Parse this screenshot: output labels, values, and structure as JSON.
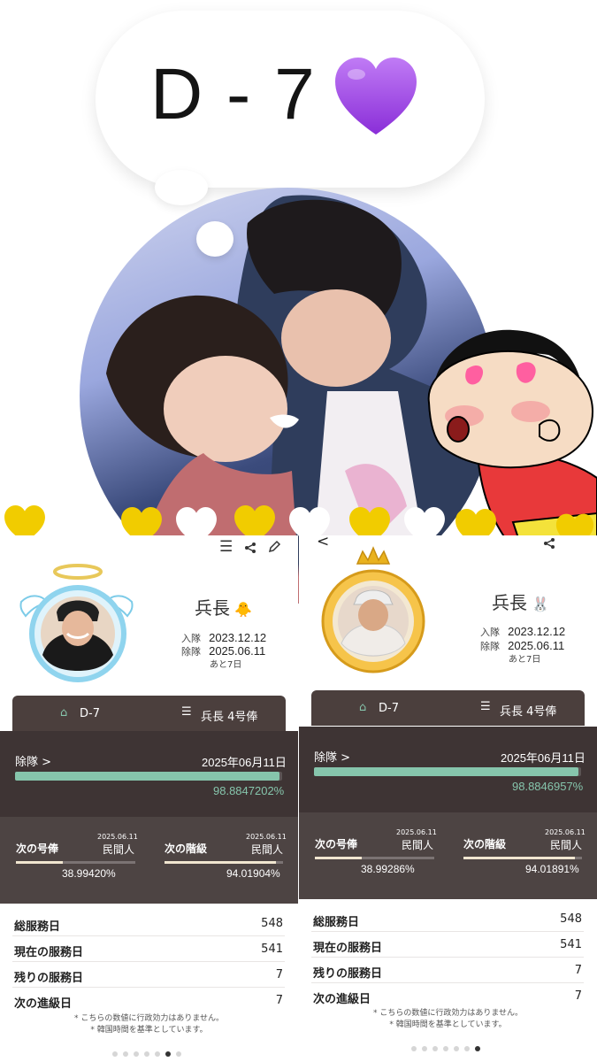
{
  "top": {
    "dday_text": "D - 7",
    "heart_color": "#a64ee8"
  },
  "left": {
    "rank": "兵長",
    "rank_emoji": "🐥",
    "enlist_label": "入隊",
    "enlist_date": "2023.12.12",
    "discharge_label": "除隊",
    "discharge_date": "2025.06.11",
    "remaining": "あと7日",
    "tab_dday": "D-7",
    "tab_pay": "兵長 4号俸",
    "discharge_row_label": "除隊 >",
    "discharge_row_date": "2025年06月11日",
    "discharge_pct": "98.8847202%",
    "discharge_progress": 0.9888,
    "next_pay_label": "次の号俸",
    "next_pay_date": "2025.06.11",
    "next_pay_status": "民間人",
    "next_pay_pct": "38.99420%",
    "next_pay_progress": 0.39,
    "next_rank_label": "次の階級",
    "next_rank_date": "2025.06.11",
    "next_rank_status": "民間人",
    "next_rank_pct": "94.01904%",
    "next_rank_progress": 0.94,
    "stats": [
      {
        "label": "総服務日",
        "value": "548"
      },
      {
        "label": "現在の服務日",
        "value": "541"
      },
      {
        "label": "残りの服務日",
        "value": "7"
      },
      {
        "label": "次の進級日",
        "value": "7"
      }
    ],
    "note1": "* こちらの数値に行政効力はありません。",
    "note2": "* 韓国時間を基準としています。"
  },
  "right": {
    "back": "<",
    "rank": "兵長",
    "rank_emoji": "🐰",
    "enlist_label": "入隊",
    "enlist_date": "2023.12.12",
    "discharge_label": "除隊",
    "discharge_date": "2025.06.11",
    "remaining": "あと7日",
    "tab_dday": "D-7",
    "tab_pay": "兵長 4号俸",
    "discharge_row_label": "除隊 >",
    "discharge_row_date": "2025年06月11日",
    "discharge_pct": "98.8846957%",
    "discharge_progress": 0.9888,
    "next_pay_label": "次の号俸",
    "next_pay_date": "2025.06.11",
    "next_pay_status": "民間人",
    "next_pay_pct": "38.99286%",
    "next_pay_progress": 0.39,
    "next_rank_label": "次の階級",
    "next_rank_date": "2025.06.11",
    "next_rank_status": "民間人",
    "next_rank_pct": "94.01891%",
    "next_rank_progress": 0.94,
    "stats": [
      {
        "label": "総服務日",
        "value": "548"
      },
      {
        "label": "現在の服務日",
        "value": "541"
      },
      {
        "label": "残りの服務日",
        "value": "7"
      },
      {
        "label": "次の進級日",
        "value": "7"
      }
    ],
    "note1": "* こちらの数値に行政効力はありません。",
    "note2": "* 韓国時間を基準としています。"
  },
  "colors": {
    "accent_green": "#86c5ac",
    "dark_brown": "#3e3434",
    "tab_brown": "#4b3f3d",
    "yellow_heart": "#f1cc00"
  },
  "icons": [
    "menu-icon",
    "share-icon",
    "edit-icon",
    "home-icon",
    "list-icon",
    "back-icon",
    "halo-icon",
    "angel-wings-icon",
    "crown-icon"
  ]
}
